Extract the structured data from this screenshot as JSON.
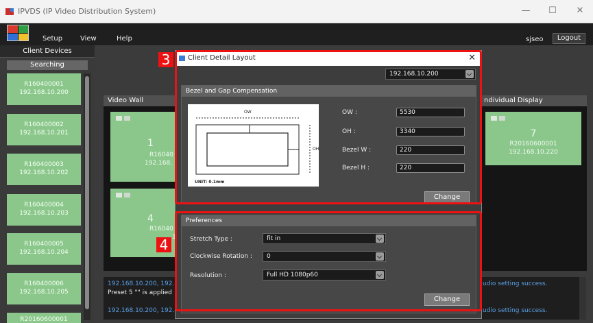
{
  "window": {
    "title": "IPVDS (IP Video Distribution System)",
    "controls": [
      "—",
      "☐",
      "✕"
    ]
  },
  "menu": {
    "items": [
      "Setup",
      "View",
      "Help"
    ],
    "user": "sjseo",
    "logout_label": "Logout"
  },
  "sidebar": {
    "title": "Client Devices",
    "status": "Searching",
    "clients": [
      {
        "id": "R160400001",
        "ip": "192.168.10.200"
      },
      {
        "id": "R160400002",
        "ip": "192.168.10.201"
      },
      {
        "id": "R160400003",
        "ip": "192.168.10.202"
      },
      {
        "id": "R160400004",
        "ip": "192.168.10.203"
      },
      {
        "id": "R160400005",
        "ip": "192.168.10.204"
      },
      {
        "id": "R160400006",
        "ip": "192.168.10.205"
      },
      {
        "id": "R20160600001",
        "ip": ""
      }
    ]
  },
  "video_wall": {
    "title": "Video Wall",
    "cells": [
      {
        "num": "1",
        "id": "R16040",
        "ip": "192.168."
      },
      {
        "num": "4",
        "id": "R16040",
        "ip": "1"
      }
    ]
  },
  "individual_display": {
    "title": "ndividual Display",
    "cell": {
      "num": "7",
      "id": "R20160600001",
      "ip": "192.168.10.220"
    }
  },
  "log": {
    "line1_left": "192.168.10.200, 192.",
    "line1_right": "udio setting success.",
    "line2_left": "Preset 5 \"\" is applied",
    "line3_left": "192.168.10.200, 192.",
    "line3_right": "udio setting success."
  },
  "dialog": {
    "title": "Client Detail Layout",
    "close": "✕",
    "device_select": "192.168.10.200",
    "bezel_group": {
      "title": "Bezel and Gap Compensation",
      "diagram": {
        "ow": "OW",
        "oh": "OH",
        "unit": "UNIT: 0.1mm"
      },
      "fields": [
        {
          "label": "OW :",
          "value": "5530"
        },
        {
          "label": "OH :",
          "value": "3340"
        },
        {
          "label": "Bezel W :",
          "value": "220"
        },
        {
          "label": "Bezel H :",
          "value": "220"
        }
      ],
      "change_label": "Change"
    },
    "prefs_group": {
      "title": "Preferences",
      "fields": [
        {
          "label": "Stretch Type :",
          "value": "fit in"
        },
        {
          "label": "Clockwise Rotation :",
          "value": "0"
        },
        {
          "label": "Resolution :",
          "value": "Full HD 1080p60"
        }
      ],
      "change_label": "Change"
    }
  },
  "annotations": {
    "callout_3": "3",
    "callout_4": "4",
    "highlight_color": "#e11111"
  }
}
